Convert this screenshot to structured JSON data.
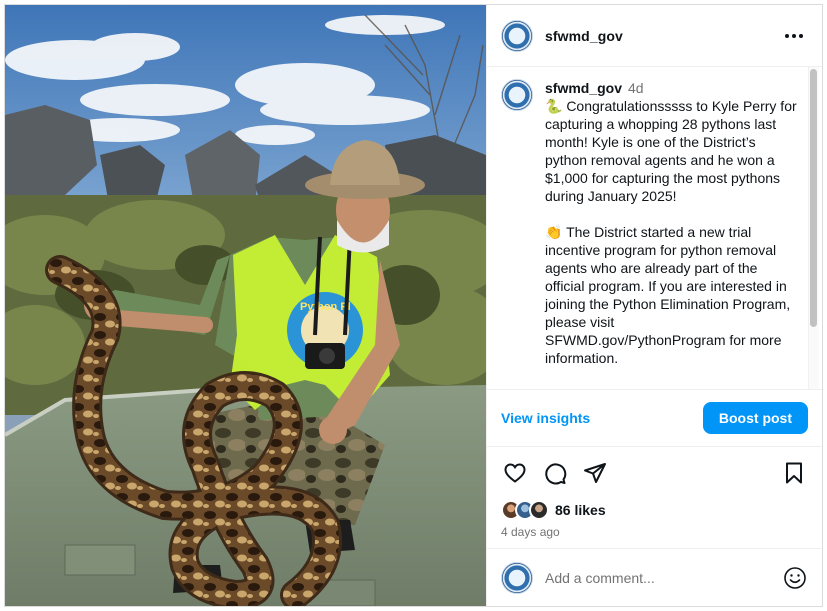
{
  "post": {
    "username": "sfwmd_gov",
    "time_ago_short": "4d",
    "caption_paragraphs": [
      "🐍 Congratulationsssss to Kyle Perry for capturing a whopping 28 pythons last month! Kyle is one of the District’s python removal agents and he won a $1,000 for capturing the most pythons during January 2025!",
      "👏 The District started a new trial incentive program for python removal agents who are already part of the official program. If you are interested in joining the Python Elimination Program, please visit SFWMD.gov/PythonProgram for more information."
    ],
    "view_insights_label": "View insights",
    "boost_label": "Boost post",
    "likes": "86 likes",
    "time_ago_long": "4 days ago",
    "comment_placeholder": "Add a comment..."
  },
  "shirt_text": "Python Pl",
  "icons": {
    "header": "more-horizontal-icon",
    "actions": [
      "heart-icon",
      "comment-icon",
      "share-icon",
      "bookmark-icon"
    ],
    "comment": "emoji-icon"
  },
  "colors": {
    "accent": "#0095f6",
    "text": "#0f1419",
    "muted": "#737373",
    "border": "#dbdbdb"
  }
}
